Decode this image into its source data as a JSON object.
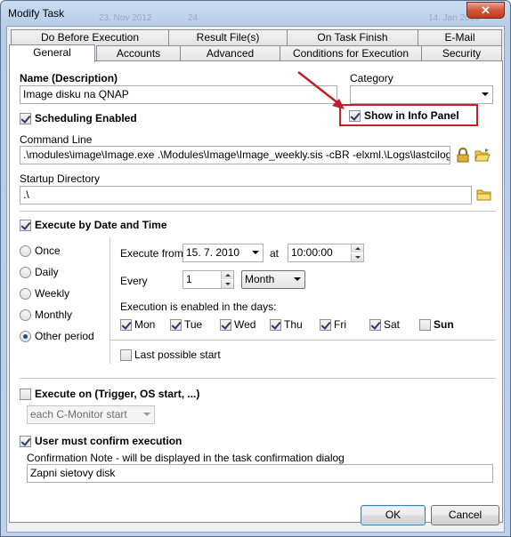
{
  "window": {
    "title": "Modify Task",
    "close_glyph": "✕",
    "ghost_title_fragments": [
      "23. Nov 2012",
      "24",
      "14. Jan 2013"
    ]
  },
  "tabs": {
    "row1": [
      "Do Before Execution",
      "Result File(s)",
      "On Task Finish",
      "E-Mail"
    ],
    "row2": [
      "General",
      "Accounts",
      "Advanced",
      "Conditions for Execution",
      "Security"
    ],
    "active": "General"
  },
  "general": {
    "name_label": "Name (Description)",
    "name_value": "Image disku na QNAP",
    "category_label": "Category",
    "category_value": "",
    "scheduling_label": "Scheduling Enabled",
    "scheduling_checked": true,
    "show_info_panel_label": "Show in Info Panel",
    "show_info_panel_checked": true,
    "command_line_label": "Command Line",
    "command_line_value": ".\\modules\\image\\Image.exe .\\Modules\\Image\\Image_weekly.sis -cBR -elxml.\\Logs\\lastcilog.xml",
    "startup_dir_label": "Startup Directory",
    "startup_dir_value": ".\\"
  },
  "schedule": {
    "execute_by_date_label": "Execute by Date and Time",
    "execute_by_date_checked": true,
    "periods": [
      "Once",
      "Daily",
      "Weekly",
      "Monthly",
      "Other period"
    ],
    "selected_period": "Other period",
    "execute_from_label": "Execute from",
    "date_value": "15.  7. 2010",
    "at_label": "at",
    "time_value": "10:00:00",
    "every_label": "Every",
    "every_value": "1",
    "unit_value": "Month",
    "days_label": "Execution is enabled in the days:",
    "days": [
      {
        "label": "Mon",
        "checked": true
      },
      {
        "label": "Tue",
        "checked": true
      },
      {
        "label": "Wed",
        "checked": true
      },
      {
        "label": "Thu",
        "checked": true
      },
      {
        "label": "Fri",
        "checked": true
      },
      {
        "label": "Sat",
        "checked": true
      },
      {
        "label": "Sun",
        "checked": false
      }
    ],
    "last_possible_label": "Last possible start",
    "last_possible_checked": false
  },
  "trigger": {
    "label": "Execute on (Trigger, OS start, ...)",
    "checked": false,
    "select_value": "each C-Monitor start"
  },
  "confirm": {
    "label": "User must confirm execution",
    "checked": true,
    "note_label": "Confirmation Note - will be displayed in the task confirmation dialog",
    "note_value": "Zapni sietovy disk"
  },
  "buttons": {
    "ok": "OK",
    "cancel": "Cancel"
  },
  "colors": {
    "annotation_red": "#c0202a",
    "title_gradient_top": "#c9dcf1",
    "close_red": "#d4553b"
  }
}
